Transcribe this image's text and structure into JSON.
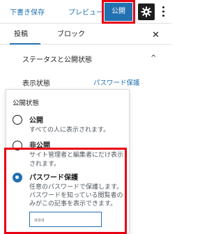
{
  "toolbar": {
    "draft_label": "下書き保存",
    "preview_label": "プレビュー",
    "publish_label": "公開",
    "settings_icon": "gear-icon",
    "more_icon": "vertical-ellipsis-icon",
    "accent_color": "#2271b1",
    "highlight_color": "#e60012"
  },
  "tabs": {
    "post_label": "投稿",
    "block_label": "ブロック",
    "close_icon": "close-icon",
    "close_glyph": "✕"
  },
  "status_panel": {
    "title": "ステータスと公開状態",
    "chevron_glyph": "^",
    "visibility_label": "表示状態",
    "visibility_value": "パスワード保護"
  },
  "visibility_popover": {
    "heading": "公開状態",
    "options": [
      {
        "label": "公開",
        "description": "すべての人に表示されます。",
        "selected": false
      },
      {
        "label": "非公開",
        "description_line1": "サイト管理者と編集者にだけ表示",
        "description_line2": "されます。",
        "selected": false
      },
      {
        "label": "パスワード保護",
        "description_line1": "任意のパスワードで保護します。",
        "description_line2": "パスワードを知っている閲覧者の",
        "description_line3": "みがこの記事を表示できます。",
        "selected": true
      }
    ],
    "password_value": "aaa"
  }
}
